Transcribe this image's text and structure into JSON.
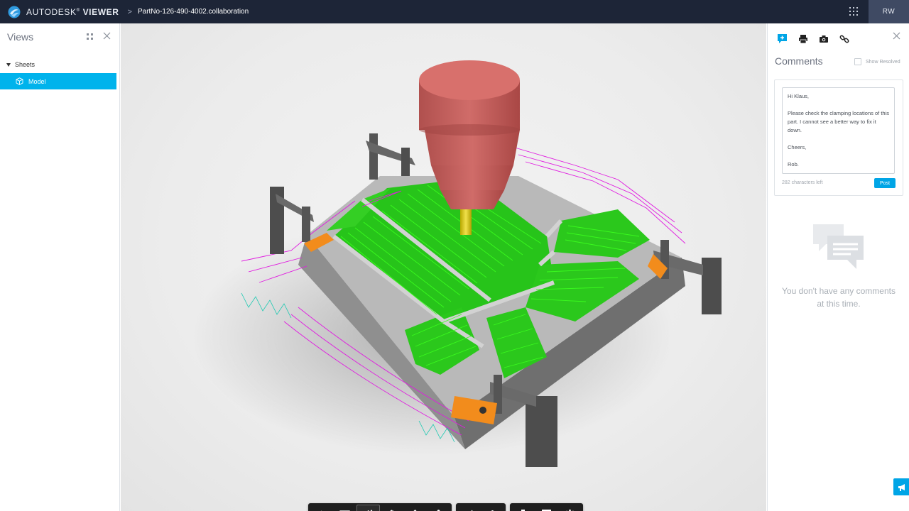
{
  "app": {
    "brand_light": "AUTODESK",
    "brand_reg": "®",
    "brand_bold": "VIEWER",
    "breadcrumb_sep": ">",
    "document_name": "PartNo-126-490-4002.collaboration",
    "user_initials": "RW"
  },
  "views_panel": {
    "title": "Views",
    "sheets_label": "Sheets",
    "model_label": "Model"
  },
  "comments_panel": {
    "title": "Comments",
    "show_resolved_label": "Show Resolved",
    "comment_draft": "Hi Klaus,\n\nPlease check the clamping locations of this part.  I cannot see a better way to fix it down.\n\nCheers,\n\nRob.",
    "chars_left": "282 characters left",
    "post_label": "Post",
    "empty_message": "You don't have any comments at this time."
  },
  "toolbar": {
    "groups": [
      [
        "home-icon",
        "fit-view-icon",
        "orbit-icon",
        "pan-icon",
        "zoom-icon",
        "first-person-icon"
      ],
      [
        "measure-icon",
        "explode-icon"
      ],
      [
        "model-browser-icon",
        "properties-icon",
        "settings-icon"
      ]
    ],
    "active": "orbit-icon"
  },
  "colors": {
    "topbar": "#1d2537",
    "accent": "#00b3ec",
    "toolpath_green": "#22d400",
    "toolpath_magenta": "#d400d4",
    "tool_red": "#c8605d",
    "part_gray": "#a8a8a8",
    "clamp_orange": "#f28c1c"
  }
}
